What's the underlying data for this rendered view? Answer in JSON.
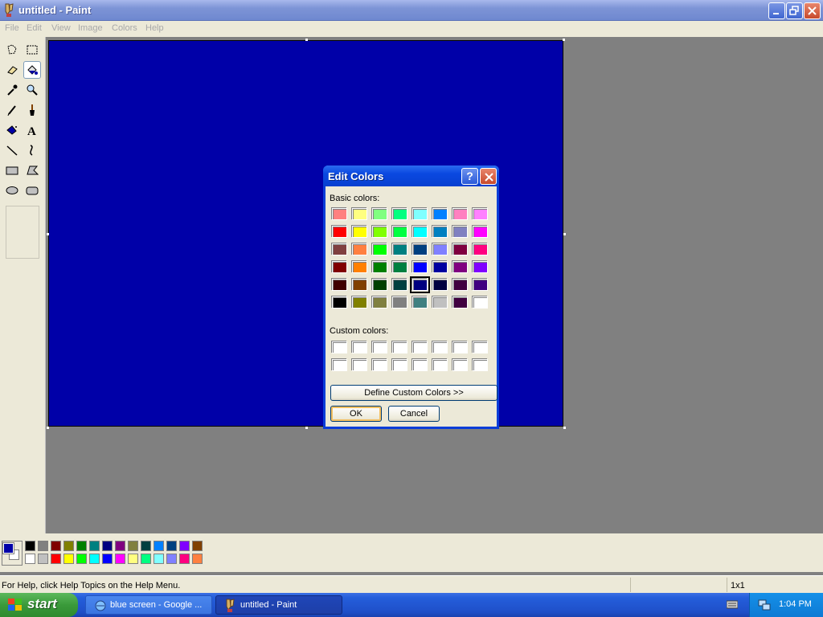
{
  "window": {
    "title": "untitled - Paint"
  },
  "menu": [
    "File",
    "Edit",
    "View",
    "Image",
    "Colors",
    "Help"
  ],
  "tools": [
    {
      "name": "free-form-select-icon",
      "selected": false
    },
    {
      "name": "select-icon",
      "selected": false
    },
    {
      "name": "eraser-icon",
      "selected": false
    },
    {
      "name": "fill-with-color-icon",
      "selected": true
    },
    {
      "name": "pick-color-icon",
      "selected": false
    },
    {
      "name": "magnifier-icon",
      "selected": false
    },
    {
      "name": "pencil-icon",
      "selected": false
    },
    {
      "name": "brush-icon",
      "selected": false
    },
    {
      "name": "airbrush-icon",
      "selected": false
    },
    {
      "name": "text-icon",
      "selected": false
    },
    {
      "name": "line-icon",
      "selected": false
    },
    {
      "name": "curve-icon",
      "selected": false
    },
    {
      "name": "rectangle-icon",
      "selected": false
    },
    {
      "name": "polygon-icon",
      "selected": false
    },
    {
      "name": "ellipse-icon",
      "selected": false
    },
    {
      "name": "rounded-rectangle-icon",
      "selected": false
    }
  ],
  "canvas": {
    "color": "#0000a8"
  },
  "palette": {
    "foreground": "#0000a8",
    "background": "#ffffff",
    "top_row": [
      "#000000",
      "#808080",
      "#800000",
      "#808000",
      "#008000",
      "#008080",
      "#000080",
      "#800080",
      "#808040",
      "#004040",
      "#0080ff",
      "#004080",
      "#8000ff",
      "#804000"
    ],
    "bottom_row": [
      "#ffffff",
      "#c0c0c0",
      "#ff0000",
      "#ffff00",
      "#00ff00",
      "#00ffff",
      "#0000ff",
      "#ff00ff",
      "#ffff80",
      "#00ff80",
      "#80ffff",
      "#8080ff",
      "#ff0080",
      "#ff8040"
    ]
  },
  "status": {
    "help_text": "For Help, click Help Topics on the Help Menu.",
    "size": "1x1"
  },
  "dialog": {
    "title": "Edit Colors",
    "help_glyph": "?",
    "basic_label": "Basic colors:",
    "custom_label": "Custom colors:",
    "define_label": "Define Custom Colors >>",
    "ok_label": "OK",
    "cancel_label": "Cancel",
    "selected_index": 36,
    "basic_colors": [
      "#ff8080",
      "#ffff80",
      "#80ff80",
      "#00ff80",
      "#80ffff",
      "#0080ff",
      "#ff80c0",
      "#ff80ff",
      "#ff0000",
      "#ffff00",
      "#80ff00",
      "#00ff40",
      "#00ffff",
      "#0080c0",
      "#8080c0",
      "#ff00ff",
      "#804040",
      "#ff8040",
      "#00ff00",
      "#008080",
      "#004080",
      "#8080ff",
      "#800040",
      "#ff0080",
      "#800000",
      "#ff8000",
      "#008000",
      "#008040",
      "#0000ff",
      "#0000a0",
      "#800080",
      "#8000ff",
      "#400000",
      "#804000",
      "#004000",
      "#004040",
      "#000080",
      "#000040",
      "#400040",
      "#400080",
      "#000000",
      "#808000",
      "#808040",
      "#808080",
      "#408080",
      "#c0c0c0",
      "#400040",
      "#ffffff"
    ],
    "custom_colors": [
      "#ffffff",
      "#ffffff",
      "#ffffff",
      "#ffffff",
      "#ffffff",
      "#ffffff",
      "#ffffff",
      "#ffffff",
      "#ffffff",
      "#ffffff",
      "#ffffff",
      "#ffffff",
      "#ffffff",
      "#ffffff",
      "#ffffff",
      "#ffffff"
    ]
  },
  "taskbar": {
    "start_label": "start",
    "tasks": [
      "blue screen - Google ...",
      "untitled - Paint"
    ],
    "clock": "1:04 PM"
  }
}
